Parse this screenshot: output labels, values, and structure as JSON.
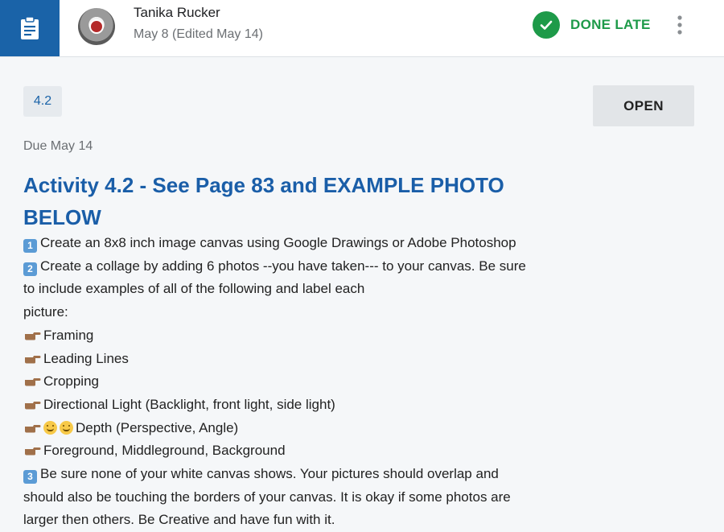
{
  "header": {
    "author": "Tanika Rucker",
    "date": "May 8 (Edited May 14)",
    "status": "DONE LATE"
  },
  "assignment": {
    "tag": "4.2",
    "open_label": "OPEN",
    "due": "Due May 14",
    "title": "Activity 4.2 - See Page 83 and EXAMPLE PHOTO BELOW"
  },
  "body": {
    "steps": [
      {
        "num": "1",
        "line": "Create an 8x8 inch image canvas using Google Drawings or Adobe Photoshop"
      },
      {
        "num": "2",
        "line": "Create a collage by adding 6 photos --you have taken--- to your canvas. Be sure"
      }
    ],
    "step2_cont": [
      "to include examples of all of the following and label each",
      "picture:"
    ],
    "bullets": [
      "Framing",
      "Leading Lines",
      "Cropping",
      "Directional Light (Backlight, front light, side light)",
      "Depth (Perspective, Angle)",
      "Foreground, Middleground, Background"
    ],
    "step3": {
      "num": "3",
      "lines": [
        "Be sure none of your white canvas shows. Your pictures should overlap and",
        "should also be touching the borders of your canvas. It is okay if some photos are",
        "larger then others. Be Creative and have fun with it."
      ]
    }
  },
  "colors": {
    "brand_blue": "#1a63a8",
    "title_blue": "#1a5ea8",
    "done_green": "#1e9a49",
    "open_button_bg": "#e2e5e8"
  },
  "icons": {
    "app": "assignment-clipboard-icon",
    "status": "check-circle-icon",
    "more": "more-vert-icon",
    "bullet": "pointing-hand-icon",
    "emoji": "grinning-face-icon"
  }
}
